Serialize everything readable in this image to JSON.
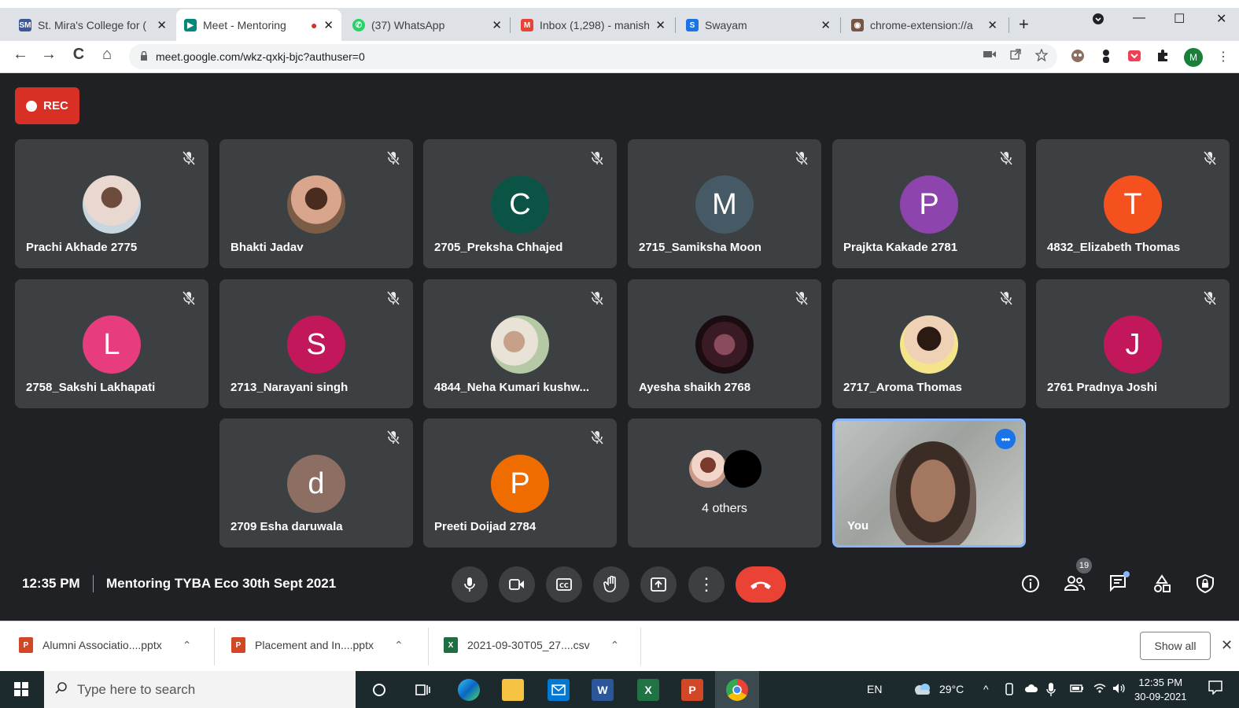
{
  "browser": {
    "tabs": [
      {
        "title": "St. Mira's College for (",
        "fav": "SM",
        "fav_color": "#3b5998",
        "close": "✕"
      },
      {
        "title": "Meet - Mentoring",
        "fav": "▶",
        "fav_color": "#00897b",
        "close": "✕",
        "recording_dot": "●"
      },
      {
        "title": "(37) WhatsApp",
        "fav": "✆",
        "fav_color": "#25d366",
        "close": "✕"
      },
      {
        "title": "Inbox (1,298) - manish",
        "fav": "M",
        "fav_color": "#ea4335",
        "close": "✕"
      },
      {
        "title": "Swayam",
        "fav": "S",
        "fav_color": "#1a73e8",
        "close": "✕"
      },
      {
        "title": "chrome-extension://a",
        "fav": "◉",
        "fav_color": "#795548",
        "close": "✕"
      }
    ],
    "new_tab": "+",
    "window_controls": {
      "minimize": "—",
      "maximize": "☐",
      "close": "✕"
    },
    "nav": {
      "back": "←",
      "forward": "→",
      "reload": "C",
      "home": "⌂"
    },
    "url": "meet.google.com/wkz-qxkj-bjc?authuser=0",
    "profile_initial": "M"
  },
  "meet": {
    "rec_label": "REC",
    "participants": [
      {
        "name": "Prachi Akhade 2775",
        "photo": "photo-1"
      },
      {
        "name": "Bhakti Jadav",
        "photo": "photo-2"
      },
      {
        "name": "2705_Preksha Chhajed",
        "initial": "C",
        "color": "#0b5345"
      },
      {
        "name": "2715_Samiksha Moon",
        "initial": "M",
        "color": "#455a64"
      },
      {
        "name": "Prajkta Kakade 2781",
        "initial": "P",
        "color": "#8e44ad"
      },
      {
        "name": "4832_Elizabeth Thomas",
        "initial": "T",
        "color": "#f4511e"
      },
      {
        "name": "2758_Sakshi Lakhapati",
        "initial": "L",
        "color": "#e73c7e"
      },
      {
        "name": "2713_Narayani singh",
        "initial": "S",
        "color": "#c2185b"
      },
      {
        "name": "4844_Neha Kumari kushw...",
        "photo": "photo-3"
      },
      {
        "name": "Ayesha shaikh 2768",
        "photo": "photo-4"
      },
      {
        "name": "2717_Aroma Thomas",
        "photo": "photo-5"
      },
      {
        "name": "2761 Pradnya Joshi",
        "initial": "J",
        "color": "#c2185b"
      },
      {
        "name": "2709 Esha daruwala",
        "initial": "d",
        "color": "#8d6e63"
      },
      {
        "name": "Preeti Doijad 2784",
        "initial": "P",
        "color": "#ef6c00"
      }
    ],
    "others_label": "4 others",
    "self_label": "You",
    "time": "12:35 PM",
    "meeting_title": "Mentoring TYBA Eco 30th Sept 2021",
    "people_count": "19"
  },
  "downloads": [
    {
      "name": "Alumni Associatio....pptx",
      "type": "P",
      "color": "#d24726"
    },
    {
      "name": "Placement and In....pptx",
      "type": "P",
      "color": "#d24726"
    },
    {
      "name": "2021-09-30T05_27....csv",
      "type": "X",
      "color": "#1d6f42"
    }
  ],
  "show_all": "Show all",
  "taskbar": {
    "search_placeholder": "Type here to search",
    "lang": "EN",
    "weather": "29°C",
    "clock_time": "12:35 PM",
    "clock_date": "30-09-2021"
  }
}
